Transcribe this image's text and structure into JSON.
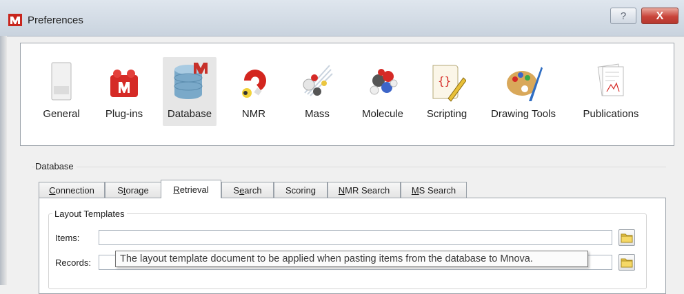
{
  "window": {
    "title": "Preferences",
    "help_label": "?",
    "close_label": "X"
  },
  "categories": [
    {
      "label": "General",
      "icon": "general-icon"
    },
    {
      "label": "Plug-ins",
      "icon": "plugins-icon"
    },
    {
      "label": "Database",
      "icon": "database-icon",
      "selected": true
    },
    {
      "label": "NMR",
      "icon": "nmr-icon"
    },
    {
      "label": "Mass",
      "icon": "mass-icon"
    },
    {
      "label": "Molecule",
      "icon": "molecule-icon"
    },
    {
      "label": "Scripting",
      "icon": "scripting-icon"
    },
    {
      "label": "Drawing Tools",
      "icon": "drawing-tools-icon"
    },
    {
      "label": "Publications",
      "icon": "publications-icon"
    }
  ],
  "database": {
    "group_label": "Database",
    "tabs": [
      {
        "label": "Connection",
        "mnemonic": "C",
        "rest": "onnection"
      },
      {
        "label": "Storage",
        "prefix": "S",
        "mnemonic": "t",
        "rest": "orage"
      },
      {
        "label": "Retrieval",
        "mnemonic": "R",
        "rest": "etrieval",
        "active": true
      },
      {
        "label": "Search",
        "prefix": "S",
        "mnemonic": "e",
        "rest": "arch"
      },
      {
        "label": "Scoring"
      },
      {
        "label": "NMR Search",
        "mnemonic": "N",
        "rest": "MR Search"
      },
      {
        "label": "MS Search",
        "mnemonic": "M",
        "rest": "S Search"
      }
    ],
    "active_tab": "Retrieval",
    "layout_templates": {
      "title": "Layout Templates",
      "items_label": "Items:",
      "items_value": "",
      "records_label": "Records:",
      "records_value": ""
    },
    "tooltip": "The layout template document to be applied when pasting items from the database to Mnova."
  }
}
